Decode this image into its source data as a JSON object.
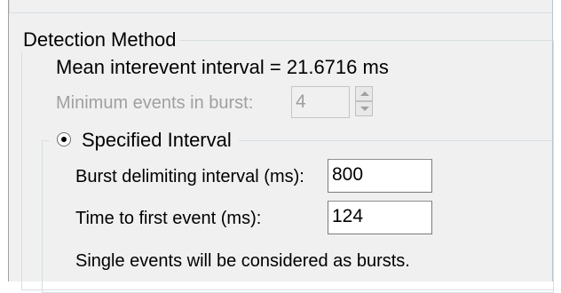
{
  "detection_method": {
    "title": "Detection Method",
    "mean_interevent": "Mean interevent interval = 21.6716 ms",
    "min_events_label": "Minimum events in burst:",
    "min_events_value": "4"
  },
  "specified_interval": {
    "label": "Specified Interval",
    "selected": true,
    "burst_interval_label": "Burst delimiting interval (ms):",
    "burst_interval_value": "800",
    "time_first_label": "Time to first event (ms):",
    "time_first_value": "124",
    "note": "Single events will be considered as bursts."
  }
}
